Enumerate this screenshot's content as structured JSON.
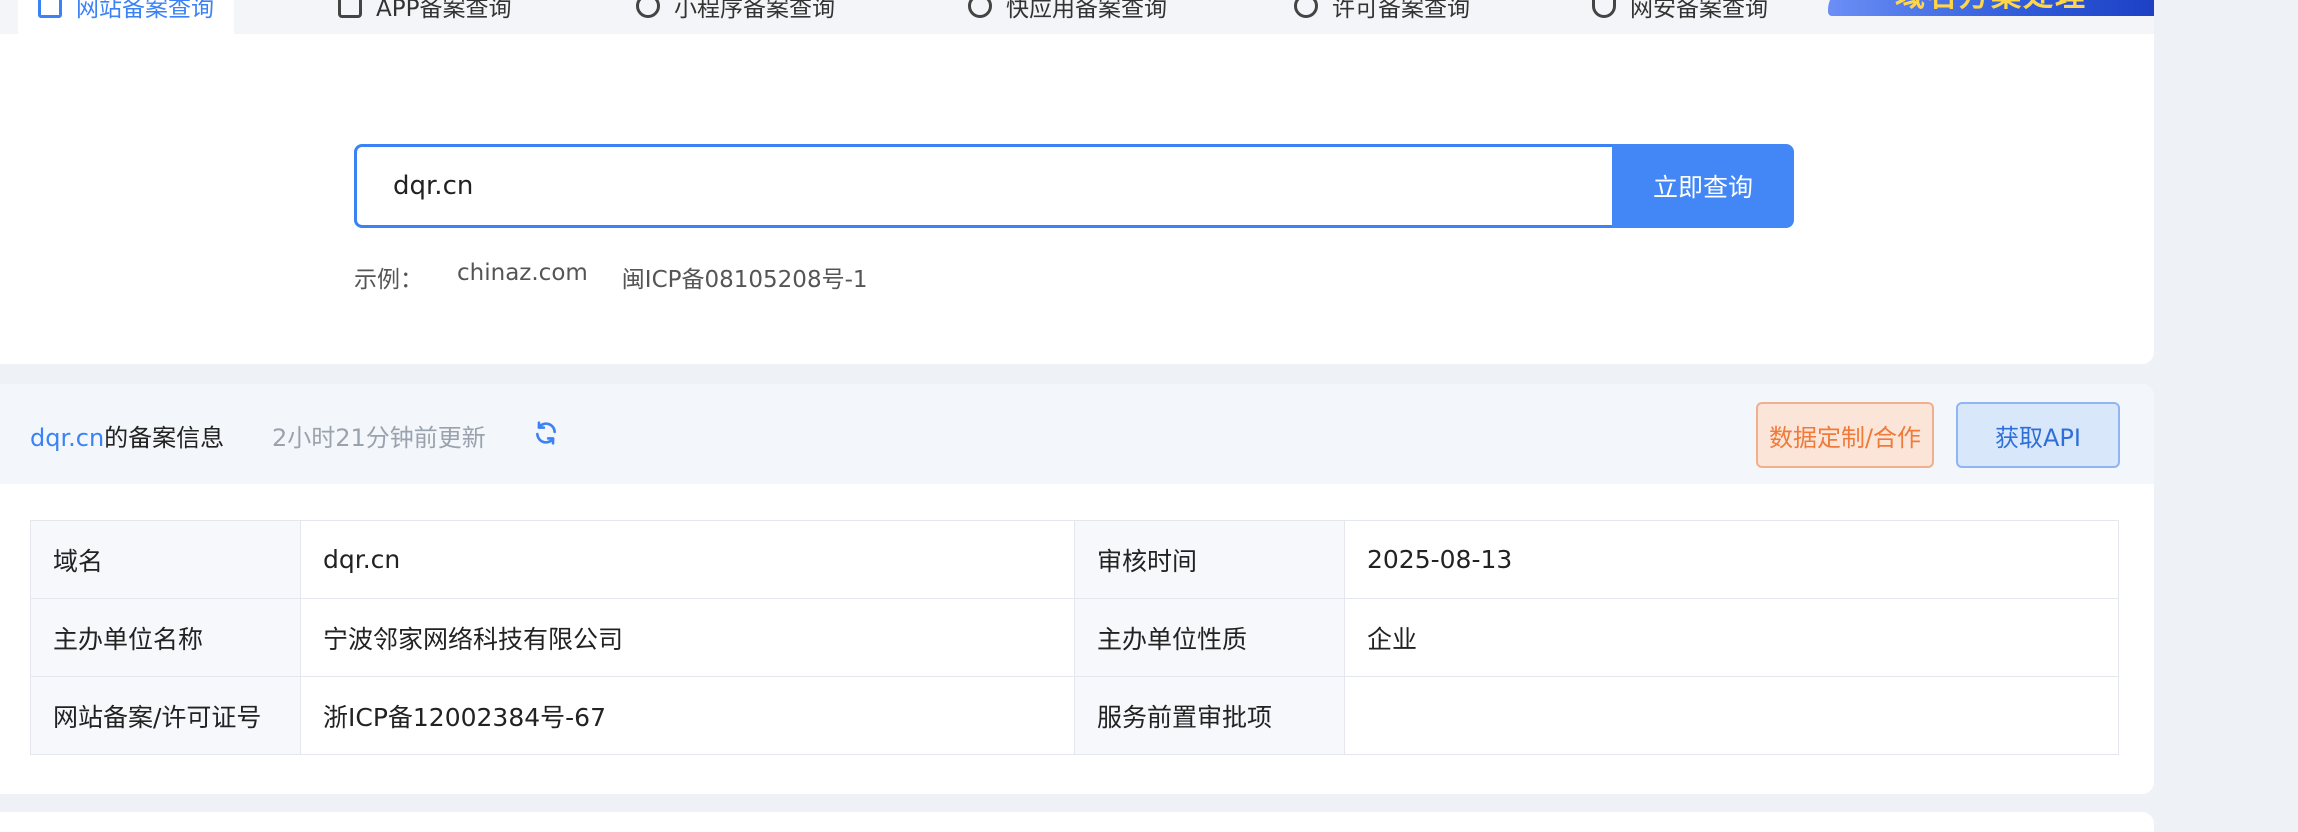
{
  "tabs": [
    {
      "label": "网站备案查询",
      "icon": "table-icon",
      "active": true
    },
    {
      "label": "APP备案查询",
      "icon": "phone-icon",
      "active": false
    },
    {
      "label": "小程序备案查询",
      "icon": "miniprogram-icon",
      "active": false
    },
    {
      "label": "快应用备案查询",
      "icon": "quickapp-icon",
      "active": false
    },
    {
      "label": "许可备案查询",
      "icon": "license-icon",
      "active": false
    },
    {
      "label": "网安备案查询",
      "icon": "shield-icon",
      "active": false
    }
  ],
  "promo": {
    "label": "域名方案处理"
  },
  "search": {
    "value": "dqr.cn",
    "button_label": "立即查询",
    "examples_label": "示例：",
    "examples": [
      "chinaz.com",
      "闽ICP备08105208号-1"
    ]
  },
  "result": {
    "domain": "dqr.cn",
    "title_suffix": "的备案信息",
    "updated": "2小时21分钟前更新",
    "refresh_icon": "refresh-icon",
    "custom_button": "数据定制/合作",
    "api_button": "获取API",
    "rows": [
      [
        {
          "label": "域名",
          "value": "dqr.cn"
        },
        {
          "label": "审核时间",
          "value": "2025-08-13"
        }
      ],
      [
        {
          "label": "主办单位名称",
          "value": "宁波邻家网络科技有限公司"
        },
        {
          "label": "主办单位性质",
          "value": "企业"
        }
      ],
      [
        {
          "label": "网站备案/许可证号",
          "value": "浙ICP备12002384号-67"
        },
        {
          "label": "服务前置审批项",
          "value": ""
        }
      ]
    ]
  },
  "colors": {
    "accent": "#3b82f6",
    "search_button": "#4287f5",
    "custom_button_text": "#f07a3a",
    "custom_button_bg": "#fbe5d9",
    "api_button_bg": "#d9e7fb"
  }
}
